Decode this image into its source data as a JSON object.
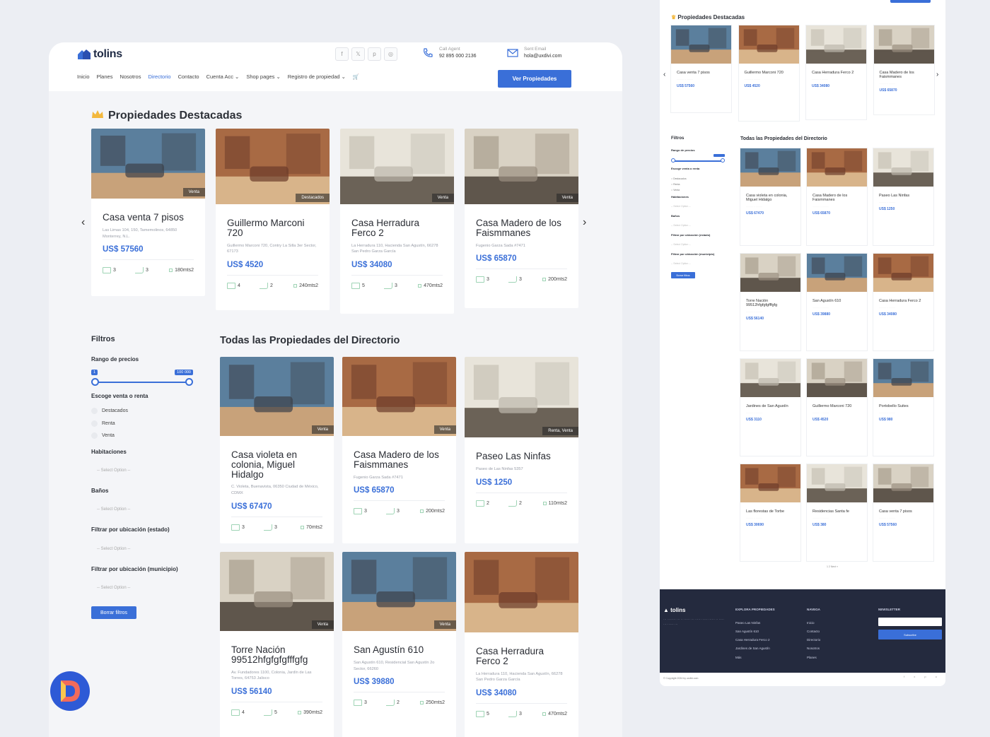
{
  "header": {
    "brand": "tolins",
    "call_label": "Call Agent",
    "call_value": "92 895 000 2136",
    "mail_label": "Sent Email",
    "mail_value": "hola@uxdivi.com",
    "cta": "Ver Propiedades",
    "socials": [
      {
        "icon": "facebook-icon",
        "glyph": "f"
      },
      {
        "icon": "x-icon",
        "glyph": "𝕏"
      },
      {
        "icon": "pinterest-icon",
        "glyph": "p"
      },
      {
        "icon": "instagram-icon",
        "glyph": "◎"
      }
    ],
    "nav": [
      {
        "label": "Inicio"
      },
      {
        "label": "Planes"
      },
      {
        "label": "Nosotros"
      },
      {
        "label": "Directorio",
        "active": true
      },
      {
        "label": "Contacto"
      },
      {
        "label": "Cuenta Acc ⌄"
      },
      {
        "label": "Shop pages ⌄"
      },
      {
        "label": "Registro de propiedad ⌄"
      },
      {
        "label": "🛒",
        "icon": "cart-icon"
      }
    ]
  },
  "featured": {
    "title": "Propiedades Destacadas",
    "items": [
      {
        "name": "Casa venta 7 pisos",
        "address": "Las Limas 104, 150, Tamemolinos, 64850 Monterrey, N.L.",
        "price": "US$ 57560",
        "beds": "3",
        "baths": "3",
        "area": "180mts2",
        "tag": "Venta"
      },
      {
        "name": "Guillermo Marconi 720",
        "address": "Guillermo Marconi 720, Contry La Silla 3er Sector, 67173",
        "price": "US$ 4520",
        "beds": "4",
        "baths": "2",
        "area": "240mts2",
        "tag": "Destacados"
      },
      {
        "name": "Casa Herradura Ferco 2",
        "address": "La Herradura 110, Hacienda San Agustín, 66278 San Pedro Garza García",
        "price": "US$ 34080",
        "beds": "5",
        "baths": "3",
        "area": "470mts2",
        "tag": "Venta"
      },
      {
        "name": "Casa Madero de los Faismmanes",
        "address": "Fugenio Garza Sada #7471",
        "price": "US$ 65870",
        "beds": "3",
        "baths": "3",
        "area": "200mts2",
        "tag": "Venta"
      }
    ]
  },
  "filters": {
    "title": "Filtros",
    "price_range": "Rango de precios",
    "min": "1",
    "max": "100 000",
    "min_value": 1,
    "max_value": 100000,
    "sale_label": "Escoge venta o renta",
    "options": [
      "Destacados",
      "Renta",
      "Venta"
    ],
    "rooms": "Habitaciones",
    "baths": "Baños",
    "state": "Filtrar por ubicación (estado)",
    "city": "Filtrar por ubicación (municipio)",
    "select": "-- Select Option --",
    "clear": "Borrar filtros"
  },
  "directory": {
    "title": "Todas las Propiedades del Directorio",
    "items": [
      {
        "name": "Casa violeta en colonia, Miguel Hidalgo",
        "address": "C. Violeta, Buenavista, 06350 Ciudad de México, CDMX",
        "price": "US$ 67470",
        "beds": "3",
        "baths": "3",
        "area": "70mts2",
        "tag": "Venta"
      },
      {
        "name": "Casa Madero de los Faismmanes",
        "address": "Fugenio Garza Sada #7471",
        "price": "US$ 65870",
        "beds": "3",
        "baths": "3",
        "area": "200mts2",
        "tag": "Venta"
      },
      {
        "name": "Paseo Las Ninfas",
        "address": "Paseo de Las Ninfas 5357",
        "price": "US$ 1250",
        "beds": "2",
        "baths": "2",
        "area": "110mts2",
        "tag": "Renta, Venta"
      },
      {
        "name": "Torre Nación 99512hfgfgfgfffgfg",
        "address": "Av. Fundadores 1100, Colonia, Jardín de Las Torres, 64753 Jalisco",
        "price": "US$ 56140",
        "beds": "4",
        "baths": "5",
        "area": "390mts2",
        "tag": "Venta"
      },
      {
        "name": "San Agustín 610",
        "address": "San Agustín 610, Residencial San Agustín 2o Sector, 66260",
        "price": "US$ 39880",
        "beds": "3",
        "baths": "2",
        "area": "250mts2",
        "tag": "Venta"
      },
      {
        "name": "Casa Herradura Ferco 2",
        "address": "La Herradura 110, Hacienda San Agustín, 66278 San Pedro Garza García",
        "price": "US$ 34080",
        "beds": "5",
        "baths": "3",
        "area": "470mts2",
        "tag": ""
      }
    ]
  },
  "preview": {
    "featured_title": "Propiedades Destacadas",
    "directory_title": "Todas las Propiedades del Directorio",
    "filters_title": "Filtros",
    "price_range": "Rango de precios",
    "sale_label": "Escoge venta o renta",
    "rooms": "Habitaciones",
    "baths": "Baños",
    "state": "Filtrar por ubicación (estado)",
    "city": "Filtrar por ubicación (municipio)",
    "clear": "Borrar filtros",
    "featured": [
      {
        "name": "Casa venta 7 pisos",
        "price": "US$ 57560"
      },
      {
        "name": "Guillermo Marconi 720",
        "price": "US$ 4520"
      },
      {
        "name": "Casa Herradura Ferco 2",
        "price": "US$ 34080"
      },
      {
        "name": "Casa Madero de los Faismmanes",
        "price": "US$ 65870"
      }
    ],
    "grid": [
      {
        "name": "Casa violeta en colonia, Miguel Hidalgo",
        "price": "US$ 67470"
      },
      {
        "name": "Casa Madero de los Faismmanes",
        "price": "US$ 65870"
      },
      {
        "name": "Paseo Las Ninfas",
        "price": "US$ 1250"
      },
      {
        "name": "Torre Nación 99512hfgfgfgfffgfg",
        "price": "US$ 56140"
      },
      {
        "name": "San Agustín 610",
        "price": "US$ 39880"
      },
      {
        "name": "Casa Herradura Ferco 2",
        "price": "US$ 34080"
      },
      {
        "name": "Jardines de San Agustín",
        "price": "US$ 3110"
      },
      {
        "name": "Guillermo Marconi 720",
        "price": "US$ 4520"
      },
      {
        "name": "Portobello Suites",
        "price": "US$ 980"
      },
      {
        "name": "Las florestas de Torbe",
        "price": "US$ 30690"
      },
      {
        "name": "Residencias Santa fe",
        "price": "US$ 380"
      },
      {
        "name": "Casa venta 7 pisos",
        "price": "US$ 57560"
      }
    ],
    "pagination": "1 2 Next »",
    "footer": {
      "brand": "tolins",
      "col1": "EXPLORA PROPIEDADES",
      "col2": "NAVEGA",
      "col3": "NEWSLETTER",
      "subscribe": "Subscribe",
      "copyright": "© Copyright 2024 by uxdivi.com",
      "links1": [
        "Paseo Las Ninfas",
        "San Agustín 610",
        "Casa Herradura Ferco 2",
        "Jardines de San Agustín",
        "Más"
      ],
      "links2": [
        "Inicio",
        "Contacto",
        "Directorio",
        "Nosotros",
        "Planes"
      ]
    }
  }
}
